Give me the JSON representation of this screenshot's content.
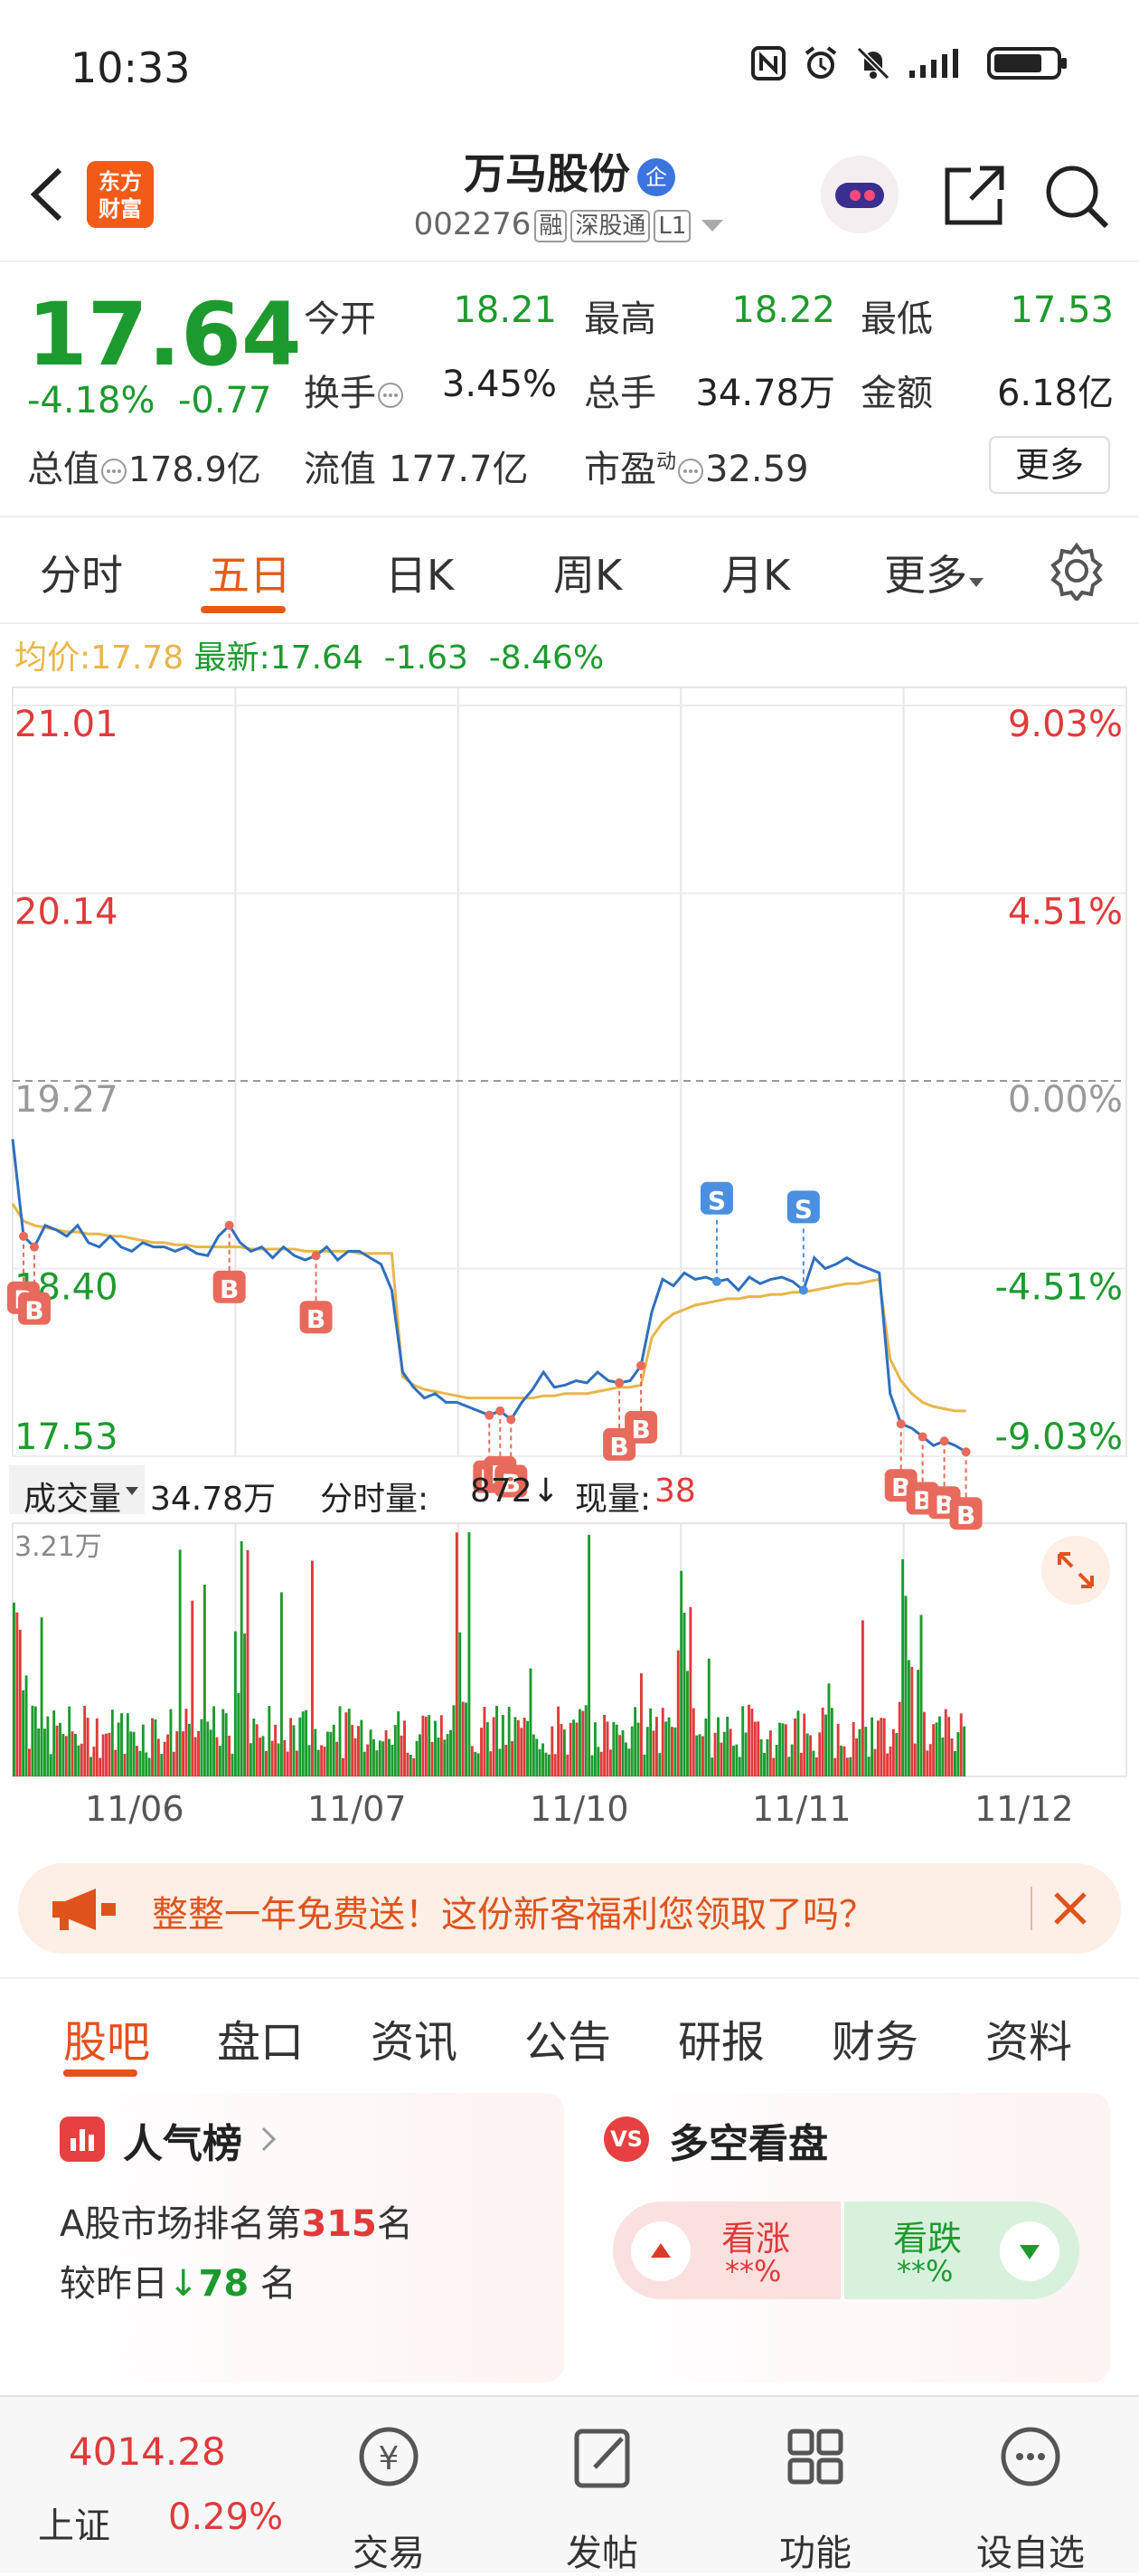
{
  "status_bar": {
    "time": "10:33"
  },
  "header": {
    "logo_text_1": "东方",
    "logo_text_2": "财富",
    "stock_name": "万马股份",
    "enterprise_badge": "企",
    "stock_code": "002276",
    "tags": [
      "融",
      "深股通",
      "L1"
    ]
  },
  "quote": {
    "price": "17.64",
    "change_pct": "-4.18%",
    "change_abs": "-0.77",
    "open_label": "今开",
    "open": "18.21",
    "high_label": "最高",
    "high": "18.22",
    "low_label": "最低",
    "low": "17.53",
    "turnover_label": "换手",
    "turnover": "3.45%",
    "volume_label": "总手",
    "volume": "34.78万",
    "amount_label": "金额",
    "amount": "6.18亿",
    "mktcap_label": "总值",
    "mktcap": "178.9亿",
    "float_label": "流值",
    "float_val": "177.7亿",
    "pe_label": "市盈",
    "pe_sup": "动",
    "pe": "32.59",
    "more_button": "更多"
  },
  "chart_tabs": {
    "items": [
      "分时",
      "五日",
      "日K",
      "周K",
      "月K",
      "更多"
    ],
    "active_index": 1
  },
  "chart_legend": {
    "avg_label": "均价:",
    "avg": "17.78",
    "latest_label": "最新:",
    "latest": "17.64",
    "latest_chg": "-1.63",
    "latest_pct": "-8.46%"
  },
  "chart_data": {
    "type": "line",
    "title": "",
    "x_categories": [
      "11/06",
      "11/07",
      "11/10",
      "11/11",
      "11/12"
    ],
    "y_ticks_price": [
      "21.01",
      "20.14",
      "19.27",
      "18.40",
      "17.53"
    ],
    "y_ticks_pct": [
      "9.03%",
      "4.51%",
      "0.00%",
      "-4.51%",
      "-9.03%"
    ],
    "ylim": [
      17.53,
      21.01
    ],
    "prev_close": 19.27,
    "grid": true,
    "series": [
      {
        "name": "价格",
        "color": "#2e6fbf",
        "values": [
          19.0,
          18.55,
          18.5,
          18.6,
          18.58,
          18.55,
          18.6,
          18.52,
          18.5,
          18.55,
          18.5,
          18.48,
          18.52,
          18.5,
          18.5,
          18.48,
          18.5,
          18.47,
          18.46,
          18.55,
          18.6,
          18.52,
          18.48,
          18.5,
          18.45,
          18.5,
          18.46,
          18.44,
          18.46,
          18.5,
          18.44,
          18.48,
          18.48,
          18.45,
          18.42,
          18.3,
          17.92,
          17.85,
          17.8,
          17.82,
          17.78,
          17.78,
          17.76,
          17.74,
          17.72,
          17.74,
          17.7,
          17.78,
          17.84,
          17.92,
          17.85,
          17.86,
          17.88,
          17.87,
          17.92,
          17.88,
          17.87,
          17.88,
          17.95,
          18.2,
          18.35,
          18.32,
          18.38,
          18.35,
          18.36,
          18.34,
          18.35,
          18.3,
          18.36,
          18.33,
          18.35,
          18.36,
          18.34,
          18.3,
          18.45,
          18.4,
          18.42,
          18.45,
          18.42,
          18.4,
          18.38,
          17.82,
          17.68,
          17.66,
          17.62,
          17.58,
          17.6,
          17.58,
          17.55
        ]
      },
      {
        "name": "均价",
        "color": "#e8b64a",
        "values": [
          18.7,
          18.62,
          18.6,
          18.59,
          18.58,
          18.57,
          18.57,
          18.56,
          18.56,
          18.55,
          18.55,
          18.54,
          18.53,
          18.52,
          18.52,
          18.51,
          18.51,
          18.5,
          18.5,
          18.5,
          18.5,
          18.5,
          18.49,
          18.49,
          18.49,
          18.49,
          18.49,
          18.48,
          18.48,
          18.48,
          18.48,
          18.48,
          18.47,
          18.47,
          18.47,
          18.47,
          17.9,
          17.86,
          17.84,
          17.83,
          17.82,
          17.81,
          17.8,
          17.8,
          17.8,
          17.8,
          17.8,
          17.8,
          17.8,
          17.81,
          17.81,
          17.82,
          17.82,
          17.82,
          17.83,
          17.84,
          17.85,
          17.85,
          17.86,
          18.08,
          18.15,
          18.19,
          18.21,
          18.23,
          18.24,
          18.25,
          18.26,
          18.26,
          18.27,
          18.27,
          18.28,
          18.28,
          18.29,
          18.29,
          18.3,
          18.31,
          18.32,
          18.33,
          18.33,
          18.34,
          18.35,
          17.98,
          17.88,
          17.82,
          17.78,
          17.76,
          17.75,
          17.74,
          17.74
        ]
      }
    ],
    "markers": [
      "B",
      "B",
      "B",
      "B",
      "B",
      "B",
      "B",
      "B",
      "B",
      "S",
      "S",
      "B",
      "B",
      "B",
      "B"
    ]
  },
  "volume_header": {
    "label": "成交量",
    "total": "34.78万",
    "tick_label": "分时量:",
    "tick_value": "872",
    "now_label": "现量:",
    "now_value": "38",
    "axis_max": "3.21万"
  },
  "banner": {
    "text": "整整一年免费送！这份新客福利您领取了吗？"
  },
  "sub_tabs": {
    "items": [
      "股吧",
      "盘口",
      "资讯",
      "公告",
      "研报",
      "财务",
      "资料"
    ],
    "active_index": 0
  },
  "popularity_card": {
    "title": "人气榜",
    "rank_prefix": "A股市场排名第",
    "rank": "315",
    "rank_suffix": "名",
    "change_prefix": "较昨日",
    "change": "78",
    "change_suffix": "名"
  },
  "sentiment_card": {
    "title": "多空看盘",
    "bull_label": "看涨",
    "bull_value": "**%",
    "bear_label": "看跌",
    "bear_value": "**%"
  },
  "bottom_nav": {
    "index_value": "4014.28",
    "index_name": "上证",
    "index_pct": "0.29%",
    "items": [
      "交易",
      "发帖",
      "功能",
      "设自选"
    ]
  },
  "colors": {
    "accent": "#e65a16",
    "up": "#e03a3a",
    "down": "#1d9a2e",
    "line": "#2e6fbf",
    "avg": "#e8b64a"
  }
}
